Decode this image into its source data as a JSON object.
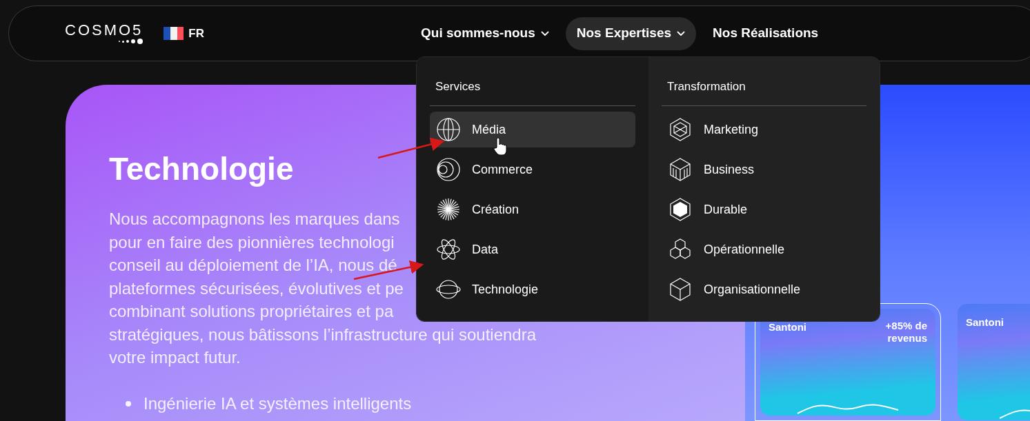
{
  "header": {
    "logo": "COSMO5",
    "language": "FR",
    "nav": [
      {
        "label": "Qui sommes-nous",
        "selected": false,
        "has_menu": true
      },
      {
        "label": "Nos Expertises",
        "selected": true,
        "has_menu": true
      },
      {
        "label": "Nos Réalisations",
        "selected": false,
        "has_menu": false
      }
    ]
  },
  "dropdown": {
    "columns": [
      {
        "heading": "Services",
        "items": [
          {
            "label": "Média",
            "selected": true
          },
          {
            "label": "Commerce",
            "selected": false
          },
          {
            "label": "Création",
            "selected": false
          },
          {
            "label": "Data",
            "selected": false
          },
          {
            "label": "Technologie",
            "selected": false
          }
        ]
      },
      {
        "heading": "Transformation",
        "items": [
          {
            "label": "Marketing",
            "selected": false
          },
          {
            "label": "Business",
            "selected": false
          },
          {
            "label": "Durable",
            "selected": false
          },
          {
            "label": "Opérationnelle",
            "selected": false
          },
          {
            "label": "Organisationnelle",
            "selected": false
          }
        ]
      }
    ]
  },
  "hero": {
    "title": "Technologie",
    "paragraph_lines": [
      "Nous accompagnons les marques dans",
      "pour en faire des pionnières technologi",
      "conseil au déploiement de l’IA, nous dé",
      "plateformes sécurisées, évolutives et pe",
      "combinant solutions propriétaires et pa",
      "stratégiques, nous bâtissons l’infrastructure qui soutiendra",
      "votre impact futur."
    ],
    "bullets": [
      "Ingénierie IA et systèmes intelligents"
    ]
  },
  "cases": [
    {
      "client": "Santoni",
      "metric": "+85% de revenus",
      "selected": true
    },
    {
      "client": "Santoni",
      "selected": false
    }
  ]
}
